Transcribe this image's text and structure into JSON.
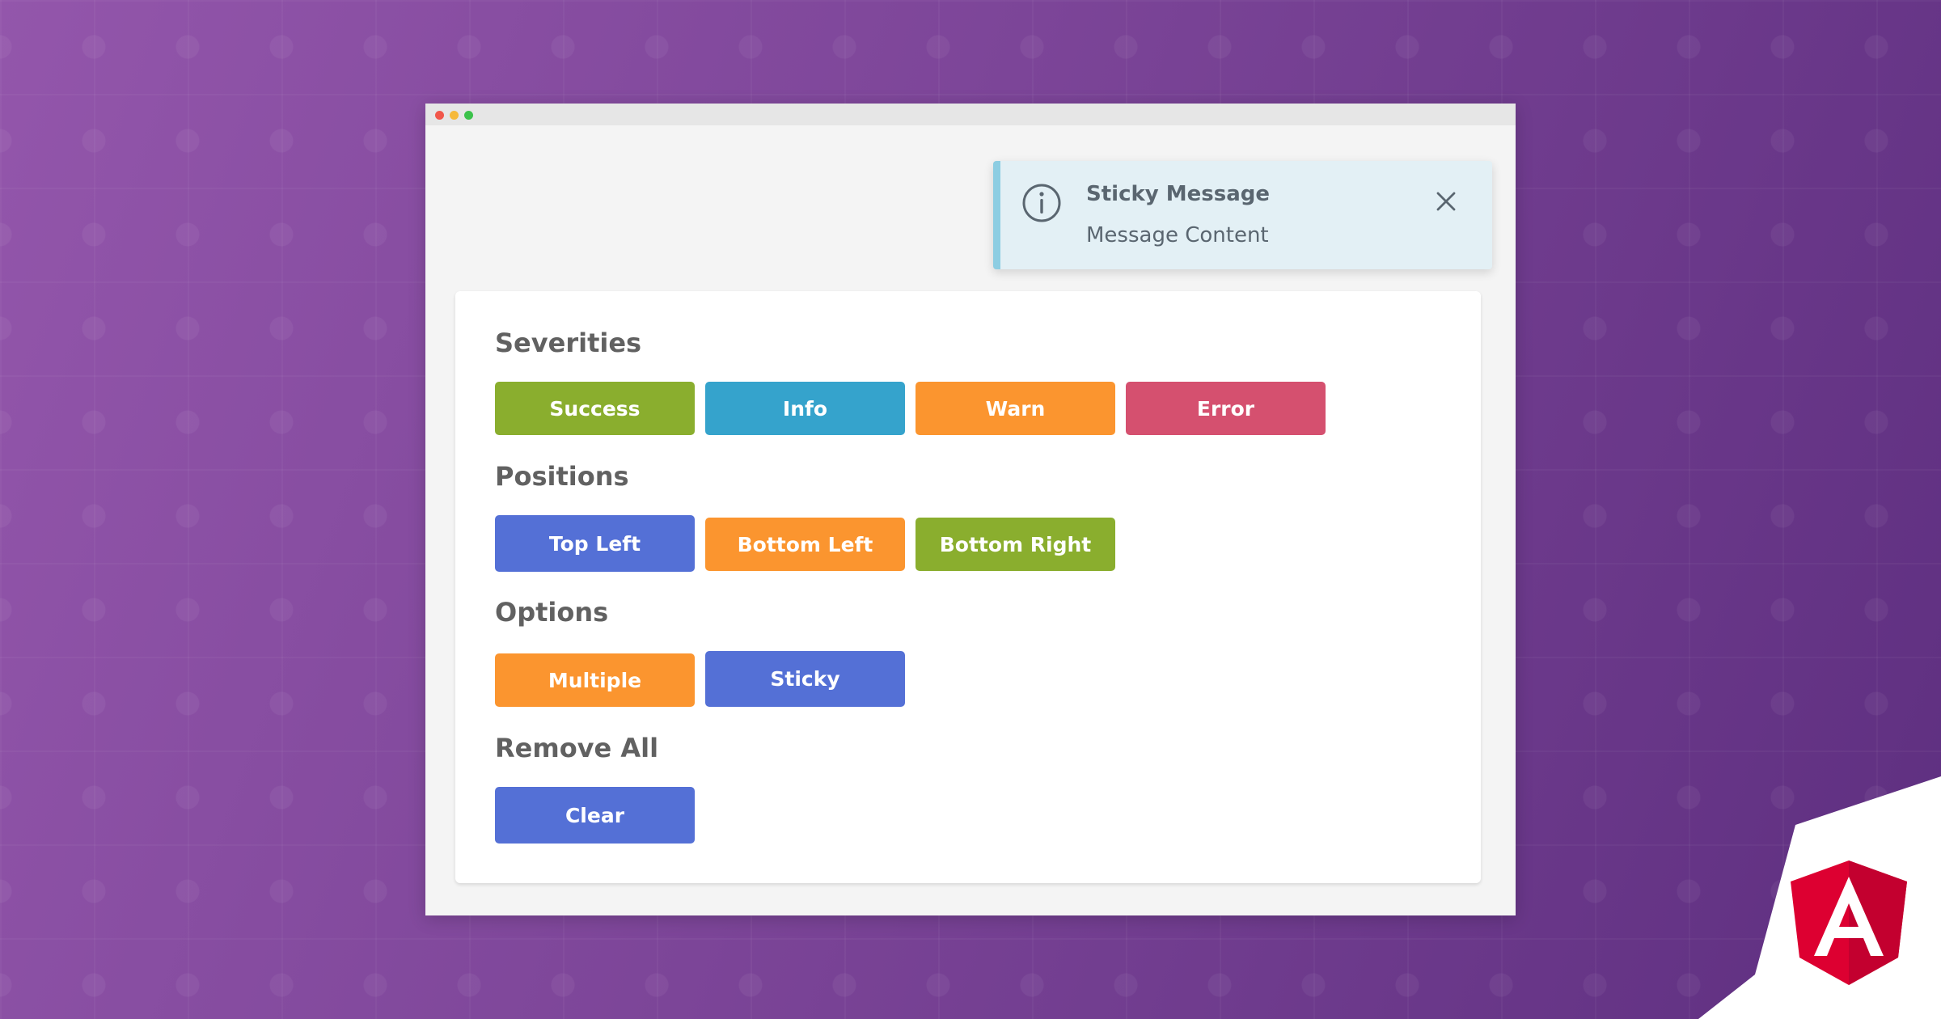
{
  "toast": {
    "title": "Sticky Message",
    "content": "Message Content",
    "icon": "info-icon",
    "close_icon": "close-icon",
    "accent_color": "#8dcde2",
    "background_color": "#e3f0f5"
  },
  "sections": {
    "severities": {
      "label": "Severities",
      "buttons": [
        {
          "label": "Success",
          "color": "#8aae2e"
        },
        {
          "label": "Info",
          "color": "#35a3cc"
        },
        {
          "label": "Warn",
          "color": "#fb952f"
        },
        {
          "label": "Error",
          "color": "#d5506f"
        }
      ]
    },
    "positions": {
      "label": "Positions",
      "buttons": [
        {
          "label": "Top Left",
          "color": "#5470d6"
        },
        {
          "label": "Bottom Left",
          "color": "#fb952f"
        },
        {
          "label": "Bottom Right",
          "color": "#8aae2e"
        }
      ]
    },
    "options": {
      "label": "Options",
      "buttons": [
        {
          "label": "Multiple",
          "color": "#fb952f"
        },
        {
          "label": "Sticky",
          "color": "#5470d6"
        }
      ]
    },
    "remove_all": {
      "label": "Remove All",
      "buttons": [
        {
          "label": "Clear",
          "color": "#5470d6"
        }
      ]
    }
  },
  "brand": {
    "logo": "angular-logo-icon",
    "color": "#dd0031"
  }
}
